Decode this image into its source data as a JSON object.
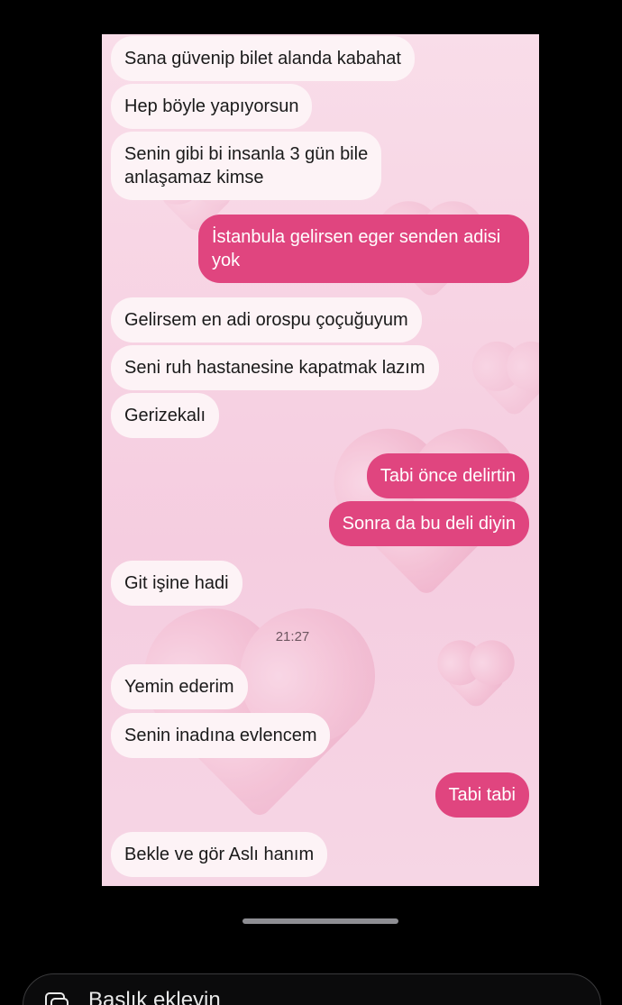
{
  "chat": {
    "messages": [
      {
        "side": "in",
        "text": "Sana güvenip bilet alanda kabahat"
      },
      {
        "side": "in",
        "text": "Hep böyle yapıyorsun"
      },
      {
        "side": "in",
        "text": "Senin gibi bi insanla 3 gün bile\nanlaşamaz kimse"
      },
      {
        "side": "out",
        "text": "İstanbula gelirsen eger senden adisi\nyok"
      },
      {
        "side": "in",
        "text": "Gelirsem en adi orospu çoçuğuyum"
      },
      {
        "side": "in",
        "text": "Seni ruh hastanesine kapatmak lazım"
      },
      {
        "side": "in",
        "text": "Gerizekalı"
      },
      {
        "side": "out",
        "text": "Tabi önce delirtin"
      },
      {
        "side": "out",
        "text": "Sonra da bu deli diyin"
      },
      {
        "side": "in",
        "text": "Git işine hadi"
      },
      {
        "side": "in",
        "text": "Yemin ederim"
      },
      {
        "side": "in",
        "text": "Senin inadına evlencem"
      },
      {
        "side": "out",
        "text": "Tabi tabi"
      },
      {
        "side": "in",
        "text": "Bekle ve gör Aslı hanım"
      }
    ],
    "timestamp": "21:27"
  },
  "caption": {
    "placeholder": "Başlık ekleyin",
    "icon": "gallery-stack-icon"
  },
  "colors": {
    "incoming_bubble": "#fdf3f6",
    "outgoing_bubble": "#e0457f",
    "background": "#f7d3e3"
  }
}
